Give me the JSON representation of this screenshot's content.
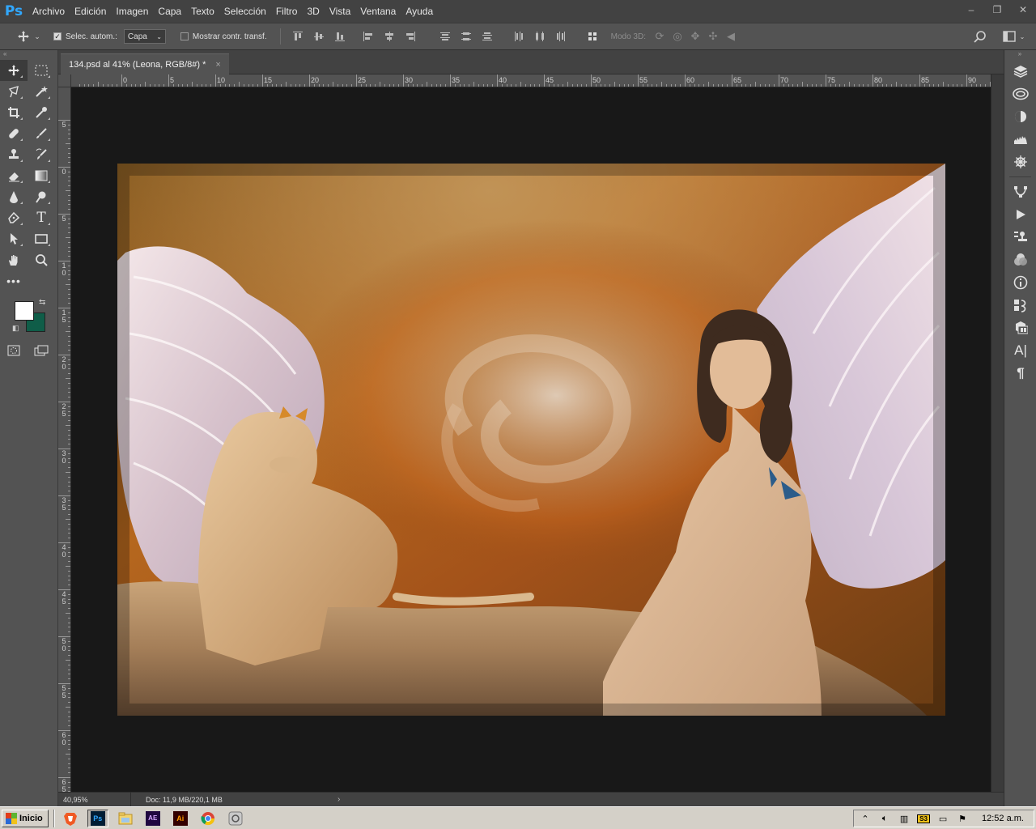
{
  "app": {
    "logo": "Ps",
    "name": "Adobe Photoshop"
  },
  "menu": [
    "Archivo",
    "Edición",
    "Imagen",
    "Capa",
    "Texto",
    "Selección",
    "Filtro",
    "3D",
    "Vista",
    "Ventana",
    "Ayuda"
  ],
  "window_controls": {
    "minimize": "–",
    "restore": "❐",
    "close": "✕"
  },
  "options_bar": {
    "move_tool_icon": "move-icon",
    "auto_select_label": "Selec. autom.:",
    "auto_select_checked": true,
    "auto_select_target": "Capa",
    "show_transform_label": "Mostrar contr. transf.",
    "show_transform_checked": false,
    "mode_3d_label": "Modo 3D:"
  },
  "document": {
    "tab_title": "134.psd al 41% (Leona, RGB/8#) *",
    "close": "×",
    "zoom": "40,95%",
    "doc_size": "Doc: 11,9 MB/220,1 MB",
    "status_arrow": "›"
  },
  "ruler_h_labels": [
    "0",
    "5",
    "10",
    "15",
    "20",
    "25",
    "30",
    "35",
    "40",
    "45",
    "50",
    "55",
    "60",
    "65",
    "70",
    "75",
    "80",
    "85",
    "90"
  ],
  "ruler_v_labels": [
    "5",
    "0",
    "5",
    "1\n0",
    "1\n5",
    "2\n0",
    "2\n5",
    "3\n0",
    "3\n5",
    "4\n0",
    "4\n5",
    "5\n0",
    "5\n5",
    "6\n0",
    "6\n5"
  ],
  "colors": {
    "foreground": "#ffffff",
    "background": "#0f5d48",
    "accent": "#31a8ff"
  },
  "tools": [
    [
      "move-tool",
      "rectangular-marquee-tool"
    ],
    [
      "lasso-tool",
      "magic-wand-tool"
    ],
    [
      "crop-tool",
      "eyedropper-tool"
    ],
    [
      "healing-brush-tool",
      "brush-tool"
    ],
    [
      "clone-stamp-tool",
      "history-brush-tool"
    ],
    [
      "eraser-tool",
      "gradient-tool"
    ],
    [
      "blur-tool",
      "dodge-tool"
    ],
    [
      "pen-tool",
      "type-tool"
    ],
    [
      "path-selection-tool",
      "rectangle-tool"
    ],
    [
      "hand-tool",
      "zoom-tool"
    ],
    [
      "edit-toolbar"
    ]
  ],
  "right_dock": [
    "layers-panel",
    "libraries-panel",
    "adjustments-panel",
    "histogram-panel",
    "navigator-panel",
    "paths-panel",
    "actions-panel",
    "clone-source-panel",
    "channels-panel",
    "info-panel",
    "history-panel",
    "3d-panel",
    "character-panel",
    "paragraph-panel"
  ],
  "taskbar": {
    "start_label": "Inicio",
    "apps": [
      {
        "name": "brave-app",
        "label": ""
      },
      {
        "name": "photoshop-app",
        "label": "Ps"
      },
      {
        "name": "explorer-app",
        "label": ""
      },
      {
        "name": "after-effects-app",
        "label": "AE"
      },
      {
        "name": "illustrator-app",
        "label": "Ai"
      },
      {
        "name": "chrome-app",
        "label": ""
      },
      {
        "name": "misc-app",
        "label": ""
      }
    ],
    "tray_badge": "S3",
    "clock": "12:52 a.m."
  }
}
